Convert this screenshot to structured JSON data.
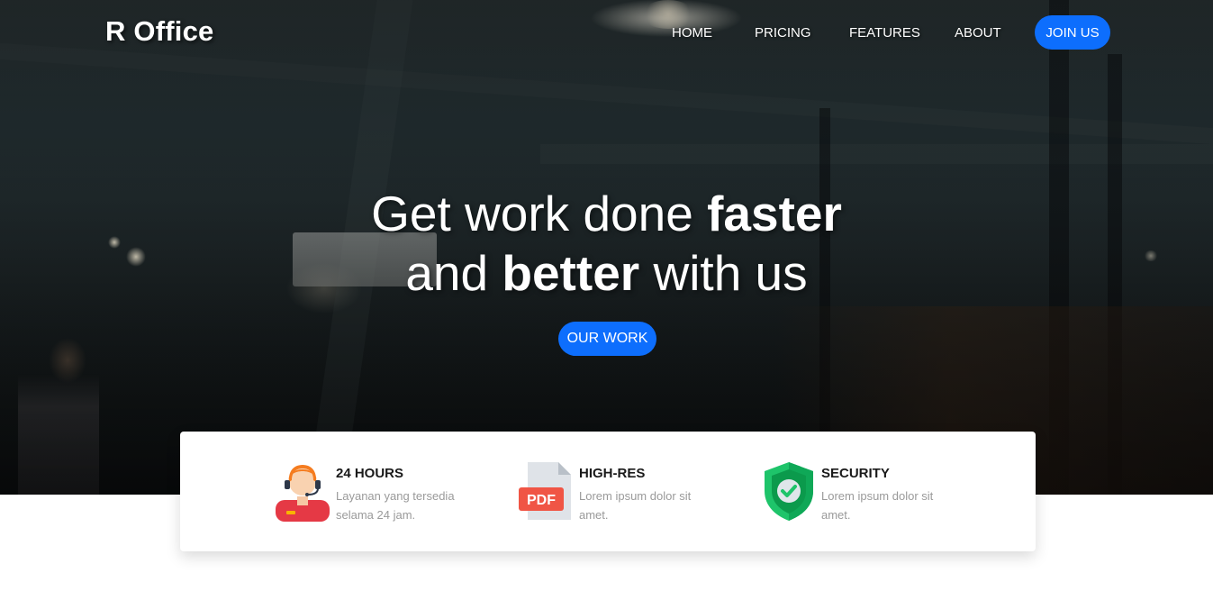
{
  "brand": {
    "name": "R Office"
  },
  "nav": {
    "items": [
      {
        "label": "HOME"
      },
      {
        "label": "PRICING"
      },
      {
        "label": "FEATURES"
      },
      {
        "label": "ABOUT"
      }
    ],
    "join_label": "JOIN US"
  },
  "hero": {
    "line1_light": "Get work done ",
    "line1_bold": "faster",
    "line2_light_a": "and ",
    "line2_bold": "better",
    "line2_light_b": " with us",
    "cta_label": "OUR WORK"
  },
  "features": [
    {
      "icon": "customer-support-icon",
      "title": "24 HOURS",
      "desc": "Layanan yang tersedia selama 24 jam."
    },
    {
      "icon": "pdf-file-icon",
      "title": "HIGH-RES",
      "desc": "Lorem ipsum dolor sit amet."
    },
    {
      "icon": "security-shield-icon",
      "title": "SECURITY",
      "desc": "Lorem ipsum dolor sit amet."
    }
  ],
  "colors": {
    "accent": "#0d6efd",
    "text_dark": "#1a1a1a",
    "text_muted": "#9a9a9a"
  }
}
